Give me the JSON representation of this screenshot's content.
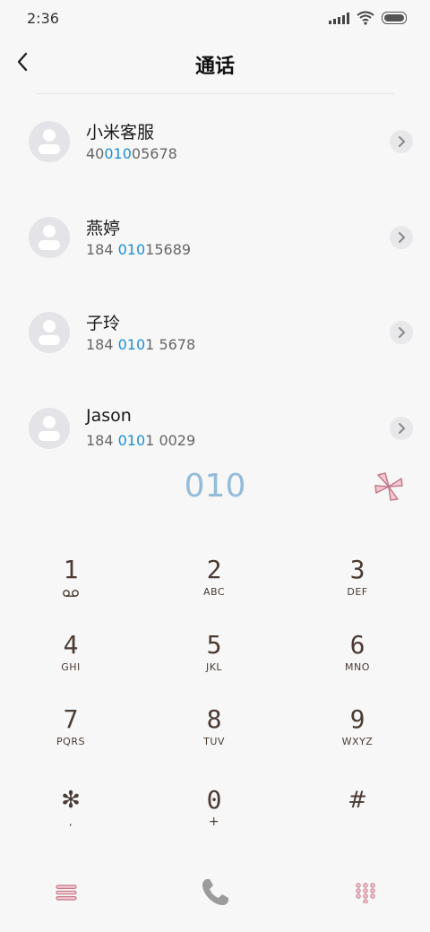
{
  "status": {
    "time": "2:36"
  },
  "header": {
    "title": "通话"
  },
  "contacts": [
    {
      "name": "小米客服",
      "num_pre": "40",
      "num_hl": "010",
      "num_post": "05678"
    },
    {
      "name": "燕婷",
      "num_pre": "184 ",
      "num_hl": "010",
      "num_post": "15689"
    },
    {
      "name": "子玲",
      "num_pre": "184 ",
      "num_hl": "010",
      "num_post": "1 5678"
    },
    {
      "name": "Jason",
      "num_pre": "184 ",
      "num_hl": "010",
      "num_post": "1 0029"
    }
  ],
  "dialer": {
    "input": "010",
    "keys": [
      {
        "digit": "1",
        "letters": ""
      },
      {
        "digit": "2",
        "letters": "ABC"
      },
      {
        "digit": "3",
        "letters": "DEF"
      },
      {
        "digit": "4",
        "letters": "GHI"
      },
      {
        "digit": "5",
        "letters": "JKL"
      },
      {
        "digit": "6",
        "letters": "MNO"
      },
      {
        "digit": "7",
        "letters": "PQRS"
      },
      {
        "digit": "8",
        "letters": "TUV"
      },
      {
        "digit": "9",
        "letters": "WXYZ"
      },
      {
        "digit": "✻",
        "letters": ","
      },
      {
        "digit": "0",
        "letters": "+"
      },
      {
        "digit": "#",
        "letters": ""
      }
    ]
  },
  "colors": {
    "highlight": "#1d8fd6",
    "dial_text": "#94bcd9",
    "key_text": "#4a3b33",
    "accent_pink": "#d98a9a"
  }
}
